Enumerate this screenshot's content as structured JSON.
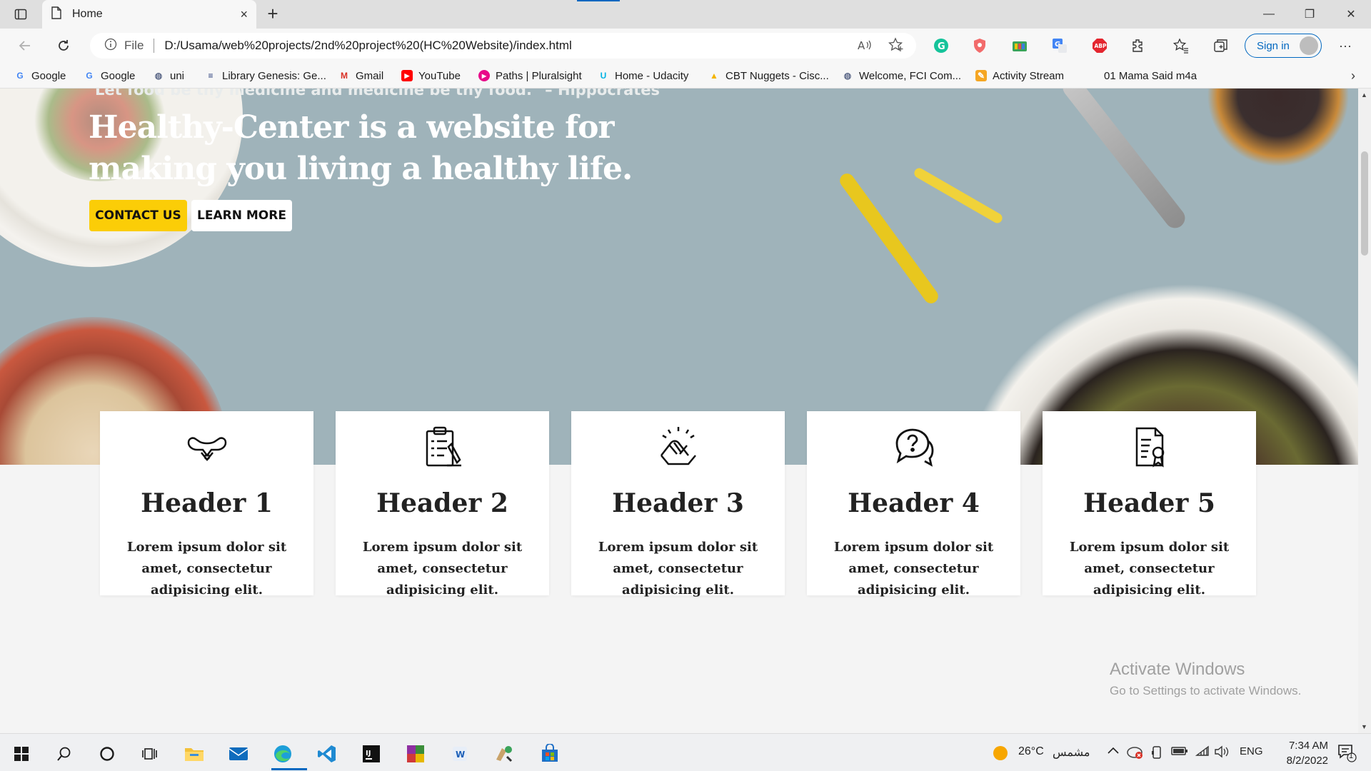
{
  "browser": {
    "tab_title": "Home",
    "close_glyph": "×",
    "new_tab_glyph": "+",
    "minimize_glyph": "—",
    "maximize_glyph": "❐",
    "close_window_glyph": "✕",
    "scheme_label": "File",
    "url": "D:/Usama/web%20projects/2nd%20project%20(HC%20Website)/index.html",
    "sign_in_label": "Sign in",
    "more_glyph": "···"
  },
  "bookmarks": [
    {
      "label": "Google",
      "icon": "google-icon",
      "color": "#4285f4",
      "glyph": "G"
    },
    {
      "label": "Google",
      "icon": "google-icon",
      "color": "#4285f4",
      "glyph": "G"
    },
    {
      "label": "uni",
      "icon": "globe-icon",
      "color": "#5f6b8a",
      "glyph": "◍"
    },
    {
      "label": "Library Genesis: Ge...",
      "icon": "library-icon",
      "color": "#243a78",
      "glyph": "≡"
    },
    {
      "label": "Gmail",
      "icon": "gmail-icon",
      "color": "#d93025",
      "glyph": "M"
    },
    {
      "label": "YouTube",
      "icon": "youtube-icon",
      "color": "#ff0000",
      "glyph": "▶"
    },
    {
      "label": "Paths | Pluralsight",
      "icon": "pluralsight-icon",
      "color": "#e80a89",
      "glyph": "▶"
    },
    {
      "label": "Home - Udacity",
      "icon": "udacity-icon",
      "color": "#02b3e4",
      "glyph": "U"
    },
    {
      "label": "CBT Nuggets - Cisc...",
      "icon": "drive-icon",
      "color": "#f4b400",
      "glyph": "▲"
    },
    {
      "label": "Welcome, FCI Com...",
      "icon": "globe-icon",
      "color": "#5f6b8a",
      "glyph": "◍"
    },
    {
      "label": "Activity Stream",
      "icon": "activity-icon",
      "color": "#f5a623",
      "glyph": "✎"
    },
    {
      "label": "01 Mama Said m4a",
      "icon": "",
      "color": "#ffffff",
      "glyph": ""
    }
  ],
  "hero": {
    "quote": "Let food be thy medicine and medicine be thy food.\" – Hippocrates",
    "title": "Healthy-Center is a website for making you living a healthy life.",
    "contact_label": "CONTACT US",
    "learn_label": "LEARN MORE",
    "accent_color": "#fbcd07"
  },
  "cards": [
    {
      "icon": "strength-icon",
      "header": "Header 1",
      "text": "Lorem ipsum dolor sit amet, consectetur adipisicing elit."
    },
    {
      "icon": "clipboard-checklist-icon",
      "header": "Header 2",
      "text": "Lorem ipsum dolor sit amet, consectetur adipisicing elit."
    },
    {
      "icon": "handshake-icon",
      "header": "Header 3",
      "text": "Lorem ipsum dolor sit amet, consectetur adipisicing elit."
    },
    {
      "icon": "question-chat-icon",
      "header": "Header 4",
      "text": "Lorem ipsum dolor sit amet, consectetur adipisicing elit."
    },
    {
      "icon": "certificate-icon",
      "header": "Header 5",
      "text": "Lorem ipsum dolor sit amet, consectetur adipisicing elit."
    }
  ],
  "watermark": {
    "line1": "Activate Windows",
    "line2": "Go to Settings to activate Windows."
  },
  "taskbar": {
    "weather_temp": "26°C",
    "weather_text": "مشمس",
    "language": "ENG",
    "time": "7:34 AM",
    "date": "8/2/2022",
    "notification_count": "1"
  }
}
